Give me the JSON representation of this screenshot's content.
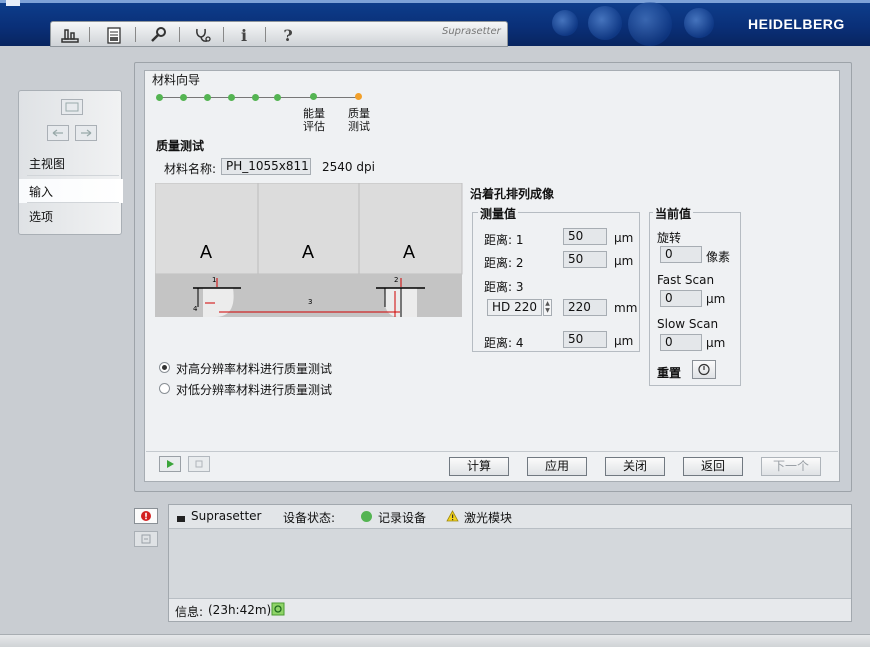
{
  "toolbar": {
    "info_glyph": "i",
    "help_glyph": "?",
    "product": "Suprasetter"
  },
  "brand": {
    "logo": "HEIDELBERG"
  },
  "nav": {
    "items": [
      {
        "label": "主视图"
      },
      {
        "label": "输入"
      },
      {
        "label": "选项"
      }
    ],
    "active_index": 1
  },
  "wizard": {
    "title": "材料向导",
    "steps": [
      {
        "label": "",
        "state": "done"
      },
      {
        "label": "",
        "state": "done"
      },
      {
        "label": "",
        "state": "done"
      },
      {
        "label": "",
        "state": "done"
      },
      {
        "label": "",
        "state": "done"
      },
      {
        "label": "",
        "state": "done"
      },
      {
        "label": "能量\n评估",
        "state": "done"
      },
      {
        "label": "质量\n测试",
        "state": "current"
      }
    ],
    "step7_line1": "能量",
    "step7_line2": "评估",
    "step8_line1": "质量",
    "step8_line2": "测试",
    "section_title": "质量测试",
    "material_label": "材料名称:",
    "material_name": "PH_1055x811",
    "resolution": "2540 dpi",
    "diagram": {
      "letters": [
        "A",
        "A",
        "A"
      ],
      "markers": [
        "1",
        "2",
        "3",
        "4"
      ]
    },
    "alignment_title": "沿着孔排列成像",
    "measured": {
      "title": "测量值",
      "dist1_label": "距离: 1",
      "dist1_value": "50",
      "dist1_unit": "μm",
      "dist2_label": "距离: 2",
      "dist2_value": "50",
      "dist2_unit": "μm",
      "dist3_label": "距离: 3",
      "dist3_select": "HD 220",
      "dist3_value": "220",
      "dist3_unit": "mm",
      "dist4_label": "距离: 4",
      "dist4_value": "50",
      "dist4_unit": "μm"
    },
    "current": {
      "title": "当前值",
      "rotation_label": "旋转",
      "rotation_value": "0",
      "rotation_unit": "像素",
      "fast_label": "Fast Scan",
      "fast_value": "0",
      "fast_unit": "μm",
      "slow_label": "Slow Scan",
      "slow_value": "0",
      "slow_unit": "μm",
      "reset_label": "重置"
    },
    "radio_high": "对高分辨率材料进行质量测试",
    "radio_low": "对低分辨率材料进行质量测试",
    "radio_selected": "high",
    "buttons": {
      "calc": "计算",
      "apply": "应用",
      "close": "关闭",
      "back": "返回",
      "next": "下一个"
    }
  },
  "status": {
    "device": "Suprasetter",
    "device_state_label": "设备状态:",
    "recorder": "记录设备",
    "laser": "激光模块",
    "info_label": "信息:",
    "info_time": "(23h:42m)"
  },
  "colors": {
    "titlebar": "#0a2f77",
    "ok_green": "#54b452",
    "current_orange": "#f2a02a",
    "warn_yellow": "#f2d21c",
    "error_red": "#d32020"
  }
}
